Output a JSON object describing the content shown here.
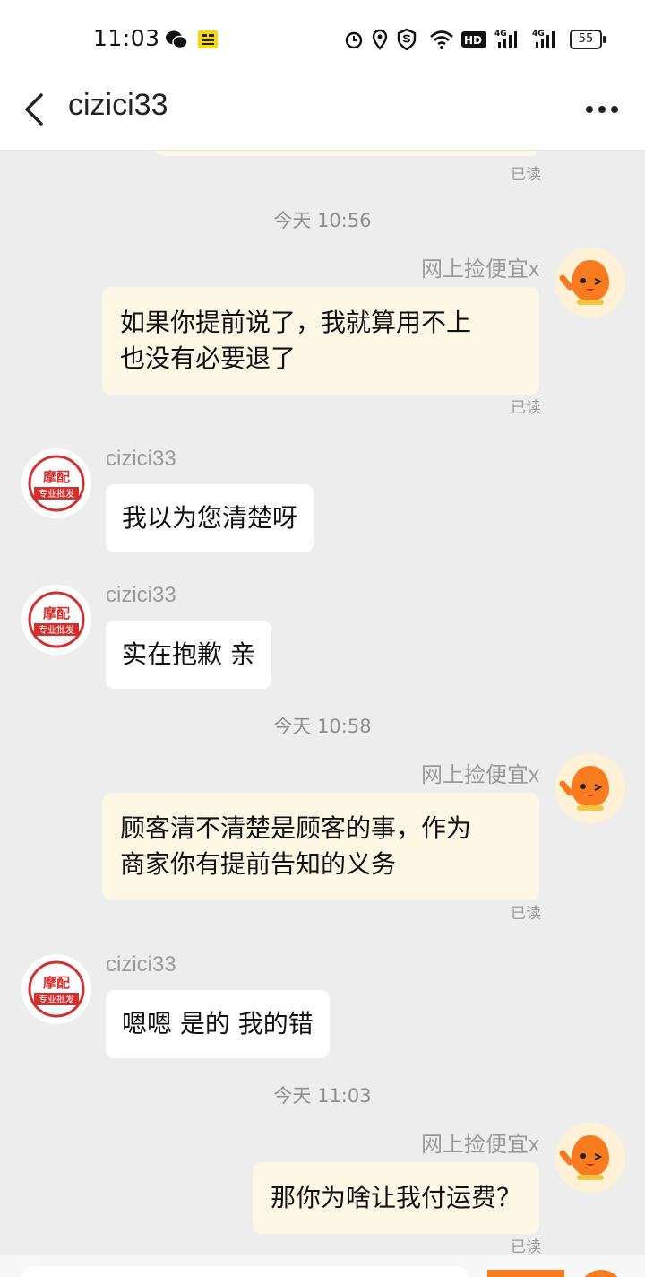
{
  "status_bar": {
    "time": "11:03",
    "battery": "55",
    "icons": [
      "wechat-icon",
      "news-app-icon",
      "alarm-icon",
      "location-icon",
      "shield-icon",
      "wifi-icon",
      "hd-icon",
      "signal-4g-icon",
      "signal-4g-icon",
      "battery-icon"
    ]
  },
  "header": {
    "title": "cizici33",
    "back_icon": "chevron-left-icon",
    "more_icon": "more-dots-icon"
  },
  "colors": {
    "my_bubble": "#fdf8e6",
    "their_bubble": "#ffffff",
    "background": "#ededed",
    "accent": "#f97b1f"
  },
  "chat": {
    "read_label": "已读",
    "timestamps": [
      "今天 10:56",
      "今天 10:58",
      "今天 11:03"
    ],
    "my_name": "网上捡便宜x",
    "shop_name": "cizici33",
    "shop_avatar_text": {
      "line1": "摩配",
      "line2": "专业批发"
    },
    "messages": [
      {
        "from": "me",
        "text_lines": [
          "如果你提前说了，我就算用不上",
          "也没有必要退了"
        ]
      },
      {
        "from": "shop",
        "text": "我以为您清楚呀"
      },
      {
        "from": "shop",
        "text": "实在抱歉 亲"
      },
      {
        "from": "me",
        "text_lines": [
          "顾客清不清楚是顾客的事，作为",
          "商家你有提前告知的义务"
        ]
      },
      {
        "from": "shop",
        "text": "嗯嗯 是的 我的错"
      },
      {
        "from": "me",
        "text": "那你为啥让我付运费？"
      }
    ]
  }
}
